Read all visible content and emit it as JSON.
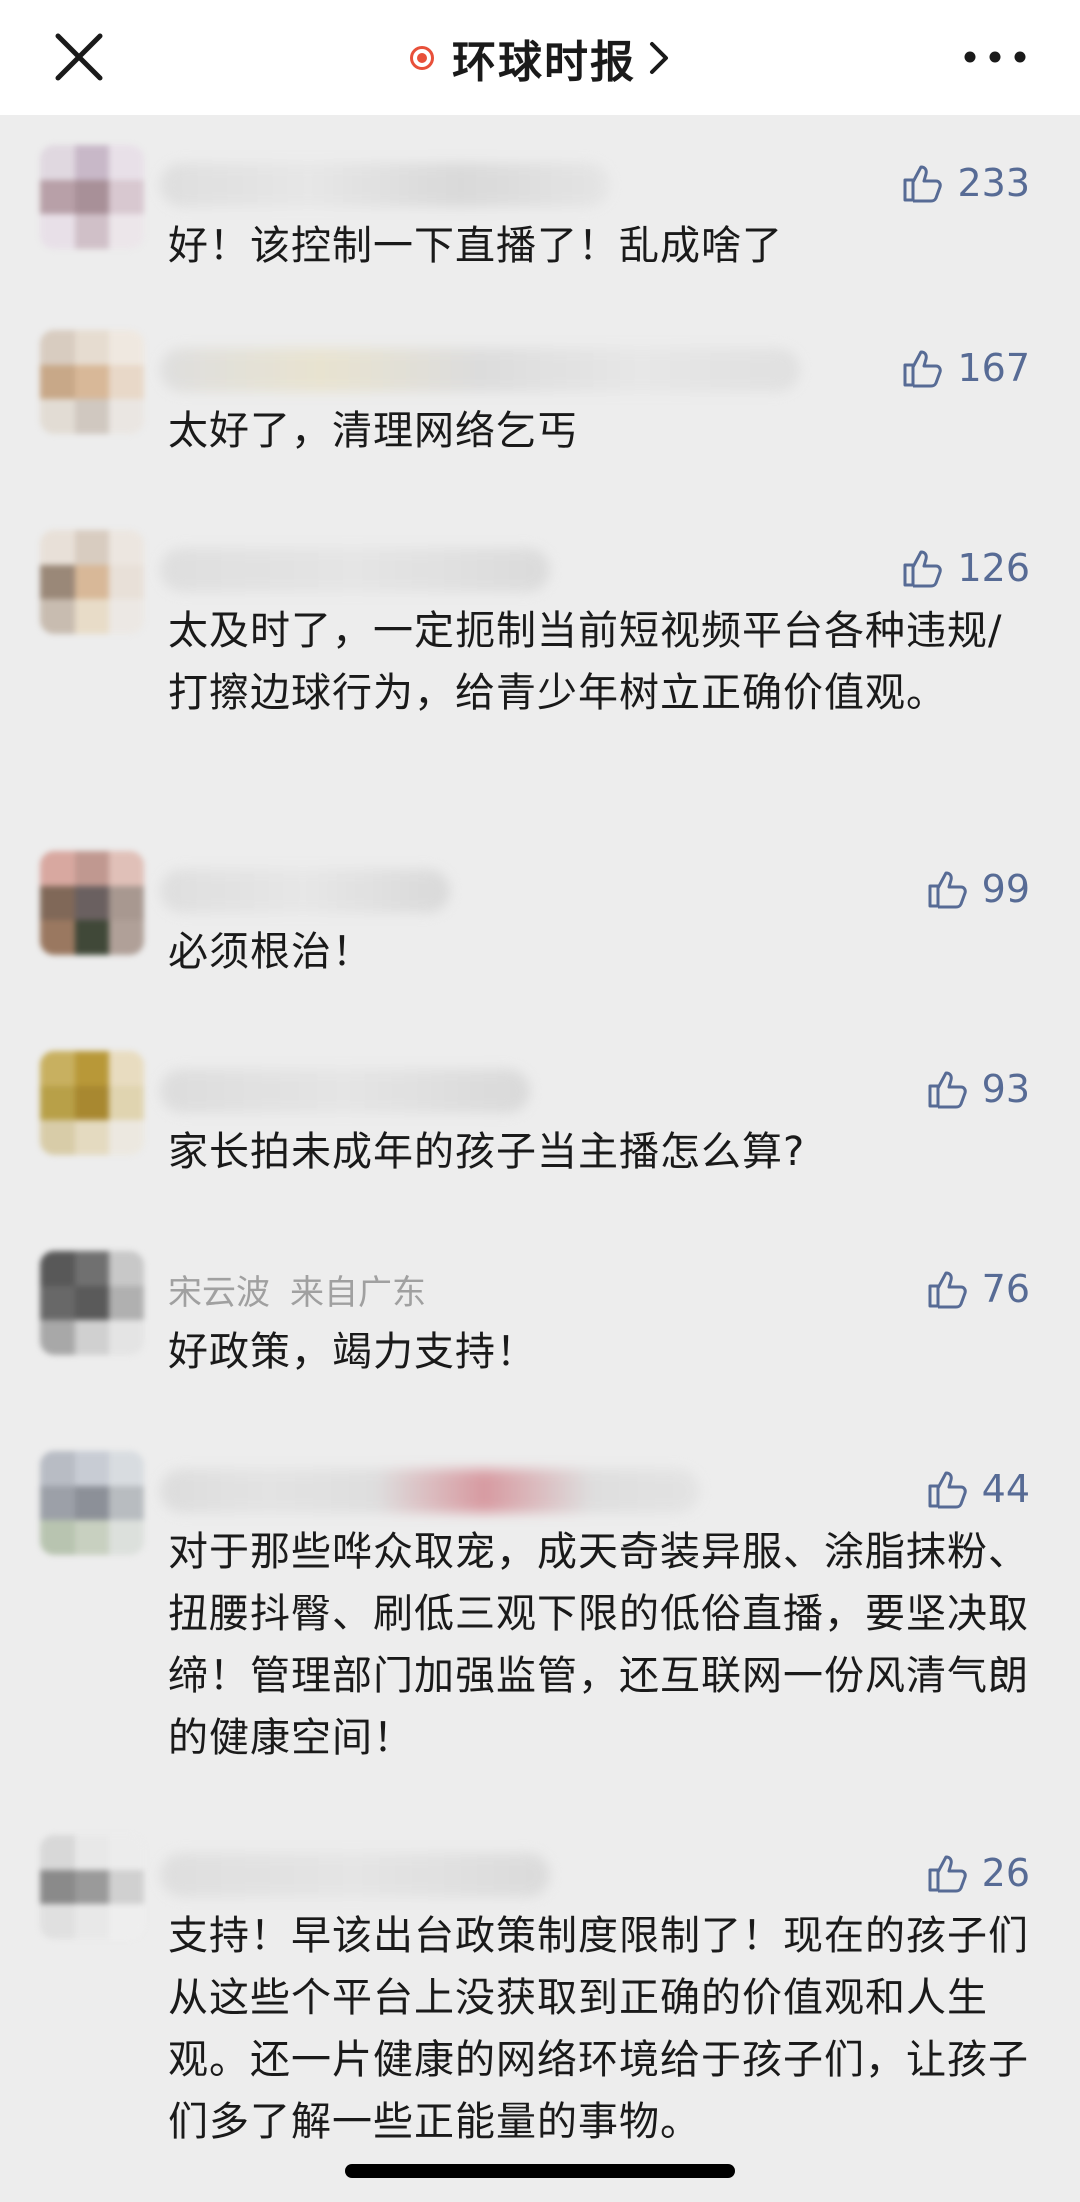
{
  "header": {
    "title": "环球时报",
    "close_icon": "close-icon",
    "more_icon": "more-icon",
    "live_dot_color": "#e8503a"
  },
  "comments": [
    {
      "username": "",
      "location": "",
      "likes": "233",
      "text": "好！该控制一下直播了！乱成啥了",
      "avatar_colors": [
        "#e0d8e0",
        "#c8b8c8",
        "#e8e0e8",
        "#b8a0a8",
        "#a89098",
        "#d8c8d0",
        "#e8e0e8",
        "#d0c0c8",
        "#ece6ea"
      ]
    },
    {
      "username": "",
      "location": "",
      "likes": "167",
      "text": "太好了，清理网络乞丐",
      "avatar_colors": [
        "#d8ccc0",
        "#e6dcd0",
        "#efe8e0",
        "#c8a888",
        "#d8b898",
        "#e8d8c8",
        "#e2dcd4",
        "#d0c8c0",
        "#eae6e2"
      ]
    },
    {
      "username": "",
      "location": "",
      "likes": "126",
      "text": "太及时了，一定扼制当前短视频平台各种违规/打擦边球行为，给青少年树立正确价值观。",
      "avatar_colors": [
        "#e8e0d8",
        "#d8ccc0",
        "#ece6e0",
        "#9a8878",
        "#d8b898",
        "#e8e0d8",
        "#c8bcb0",
        "#e8dcc8",
        "#ece8e4"
      ]
    },
    {
      "username": "",
      "location": "",
      "likes": "99",
      "text": "必须根治！",
      "avatar_colors": [
        "#d8a8a0",
        "#c09890",
        "#e0c0b8",
        "#806858",
        "#6a6060",
        "#a89890",
        "#9a7860",
        "#404838",
        "#b0a098"
      ]
    },
    {
      "username": "",
      "location": "",
      "likes": "93",
      "text": "家长拍未成年的孩子当主播怎么算?",
      "avatar_colors": [
        "#c8b060",
        "#b89838",
        "#e8dcc0",
        "#b8a048",
        "#a88830",
        "#e0d4b0",
        "#d8cca8",
        "#e4dac0",
        "#ece8e0"
      ]
    },
    {
      "username": "宋云波",
      "location": "来自广东",
      "likes": "76",
      "text": "好政策，竭力支持！",
      "avatar_colors": [
        "#585858",
        "#707070",
        "#c8c8c8",
        "#686868",
        "#5a5a5a",
        "#b0b0b0",
        "#a8a8a8",
        "#d0d0d0",
        "#e4e4e4"
      ]
    },
    {
      "username": "",
      "location": "",
      "likes": "44",
      "text": "对于那些哗众取宠，成天奇装异服、涂脂抹粉、扭腰抖臀、刷低三观下限的低俗直播，要坚决取缔！管理部门加强监管，还互联网一份风清气朗的健康空间！",
      "avatar_colors": [
        "#b8bcc4",
        "#c8ccd4",
        "#d8dce0",
        "#9ca0a8",
        "#8c9098",
        "#b8bcc0",
        "#b8c4b0",
        "#c8d0c0",
        "#dce0dc"
      ]
    },
    {
      "username": "",
      "location": "",
      "likes": "26",
      "text": "支持！早该出台政策制度限制了！现在的孩子们从这些个平台上没获取到正确的价值观和人生观。还一片健康的网络环境给于孩子们，让孩子们多了解一些正能量的事物。",
      "avatar_colors": [
        "#d8d8d8",
        "#e8e8e8",
        "#ececec",
        "#8a8a8a",
        "#9a9a9a",
        "#d0d0d0",
        "#e0e0e0",
        "#e8e8e8",
        "#eeeeee"
      ]
    }
  ]
}
